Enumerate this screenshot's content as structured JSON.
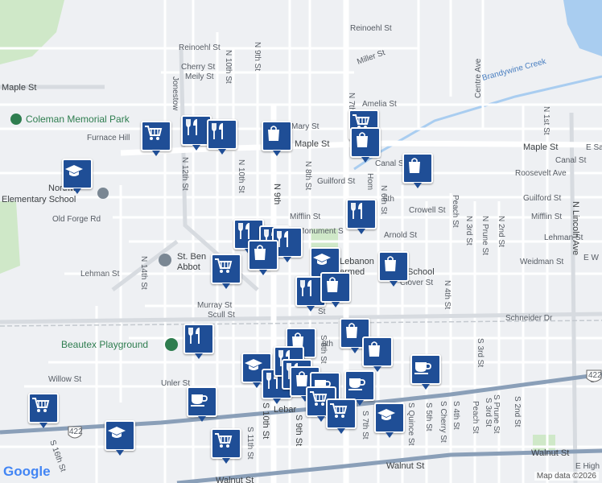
{
  "map": {
    "attribution": "Map data ©2026",
    "logo": "Google",
    "colors": {
      "background": "#eef0f3",
      "road": "#ffffff",
      "arterial": "#d7dbe0",
      "highway": "#8a9fb8",
      "park": "#cfe8c8",
      "water": "#a9cdf0",
      "marker": "#1f4e96"
    }
  },
  "labels": {
    "streets": {
      "reinoehl_top": "Reinoehl St",
      "reinoehl_left": "Reinoehl St",
      "cherry": "Cherry St",
      "meily": "Meily St",
      "n9_top": "N 9th St",
      "n10_top": "N 10th St",
      "maple_left": "Maple St",
      "maple_mid": "Maple St",
      "maple_right": "Maple St",
      "miller": "Miller St",
      "amelia": "Amelia St",
      "mary": "Mary St",
      "n7": "N 7th",
      "furnace": "Furnace Hill",
      "n10": "N 10th St",
      "n9": "N 9th",
      "n8": "N 8th St",
      "guilford_mid": "Guilford St",
      "guilford_right": "Guilford St",
      "canal": "Canal St",
      "canal_right": "Canal St",
      "roosevelt": "Roosevelt Ave",
      "old_forge": "Old Forge Rd",
      "mifflin_mid": "Mifflin St",
      "mifflin_right": "Mifflin St",
      "monument": "Monument S",
      "crowell": "Crowell St",
      "arnold": "Arnold St",
      "lehman_left": "Lehman St",
      "lehman_right": "Lehman St",
      "weidman": "Weidman St",
      "clover": "Clover St",
      "n14": "N 14th St",
      "n12": "N 12th St",
      "jonestown": "Jonestow",
      "hom": "Hom",
      "n6": "N 6th St",
      "centre": "Centre Ave",
      "n1": "N 1st St",
      "n2": "N 2nd St",
      "n3": "N 3rd St",
      "prune": "N Prune St",
      "peach": "Peach St",
      "n4": "N 4th St",
      "lincoln": "N Lincoln Ave",
      "murray": "Murray St",
      "scull": "Scull St",
      "schneider": "Schneider Dr",
      "s8": "S 8th St",
      "s3": "S 3rd St",
      "unler": "Unler St",
      "willow": "Willow St",
      "walnut_mid": "Walnut St",
      "walnut_right": "Walnut St",
      "walnut_bottom": "Walnut St",
      "s16": "S 16th St",
      "s11": "S 11th St",
      "s10": "S 10th St",
      "s9": "S 9th St",
      "s7": "S 7th St",
      "s5": "S 5th St",
      "s4": "S 4th St",
      "quince": "S Quince St",
      "cherry_s": "S Cherry St",
      "s3b": "S 3rd St",
      "prune_s": "S Prune St",
      "s2": "S 2nd St",
      "peach_s": "Peach St",
      "lebanon_town": "Lebar",
      "e_weidman": "E W",
      "e_high": "E High",
      "e_sarah": "E Sarah",
      "es": "S",
      "sixth": "6th",
      "e8": "8th",
      "n8b": "St",
      "hwy422a": "422",
      "hwy422b": "422",
      "s_label": "S",
      "dot": "St"
    },
    "places": {
      "coleman": "Coleman Memorial Park",
      "brandywine": "Brandywine Creek",
      "northwest_a": "Northw",
      "northwest_b": "Elementary School",
      "st_ben_a": "St. Ben",
      "st_ben_b": "Abbot",
      "lebanon_a": "Lebanon",
      "lebanon_b": "ermed",
      "lebanon_c": "School",
      "beautex": "Beautex Playground"
    }
  }
}
